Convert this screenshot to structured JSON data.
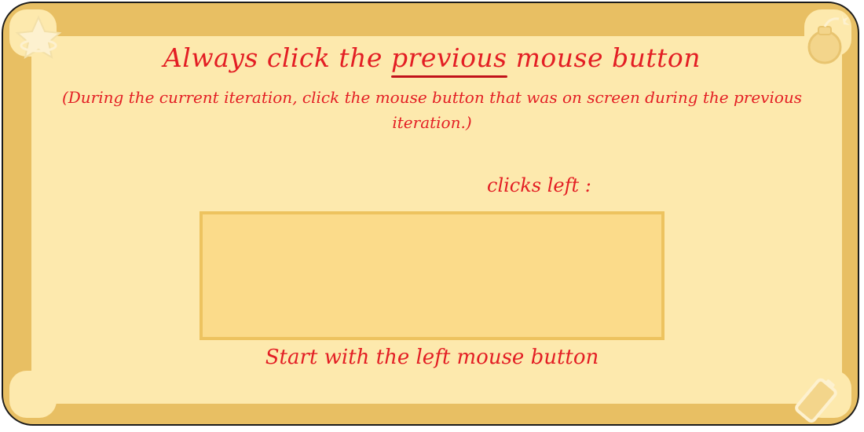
{
  "header": {
    "title_before": "Always click the ",
    "title_emphasis": "previous",
    "title_after": " mouse button",
    "subtitle": "(During the current iteration, click the mouse button that was on screen during the previous iteration.)"
  },
  "status": {
    "clicks_left_label": "clicks left :"
  },
  "footer": {
    "hint": "Start with the left mouse button"
  },
  "icons": {
    "top_left": "star-icon",
    "top_right": "bomb-icon",
    "bottom_right": "battery-icon"
  },
  "colors": {
    "frame": "#e8bf63",
    "panel": "#fde9ad",
    "text": "#e31e24",
    "click_box_fill": "#fbdb8a",
    "click_box_border": "#edc35f"
  }
}
